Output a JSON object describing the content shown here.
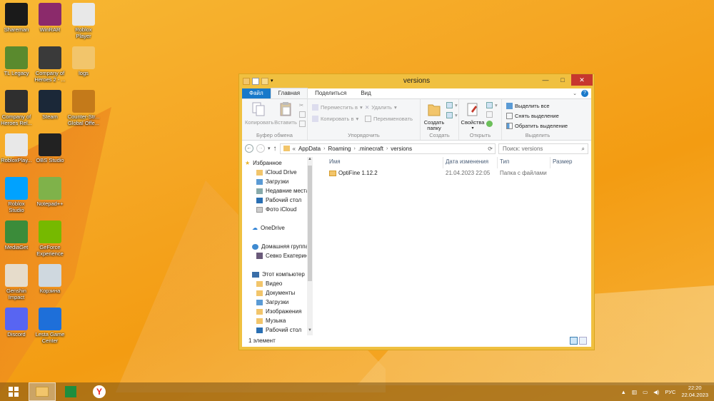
{
  "desktop": {
    "icons": [
      {
        "label": "Shareman",
        "icon": "shareman-icon",
        "color": "#1a1a1a"
      },
      {
        "label": "WinRAR",
        "icon": "winrar-icon",
        "color": "#8b2a6b"
      },
      {
        "label": "Roblox Player",
        "icon": "roblox-icon",
        "color": "#e8e8e8"
      },
      {
        "label": "TL Legacy",
        "icon": "minecraft-grass-icon",
        "color": "#5a8a2e"
      },
      {
        "label": "Company of Heroes 2 - ...",
        "icon": "coh2-icon",
        "color": "#3a3a3a"
      },
      {
        "label": "logs",
        "icon": "folder-icon",
        "color": "#f2c56b"
      },
      {
        "label": "Company of Heroes Rel...",
        "icon": "coh-icon",
        "color": "#2f2f2f"
      },
      {
        "label": "Steam",
        "icon": "steam-icon",
        "color": "#1b2838"
      },
      {
        "label": "Counter-Str... Global Offe...",
        "icon": "csgo-icon",
        "color": "#c47a1a"
      },
      {
        "label": "RobloxPlay...",
        "icon": "roblox-icon",
        "color": "#e8e8e8"
      },
      {
        "label": "OBS Studio",
        "icon": "obs-icon",
        "color": "#222"
      },
      {
        "label": "Roblox Studio",
        "icon": "roblox-studio-icon",
        "color": "#00a2ff"
      },
      {
        "label": "Notepad++",
        "icon": "notepadpp-icon",
        "color": "#7fb24a"
      },
      {
        "label": "MediaGet",
        "icon": "mediaget-icon",
        "color": "#3b8c3a"
      },
      {
        "label": "GeForce Experience",
        "icon": "nvidia-icon",
        "color": "#76b900"
      },
      {
        "label": "Genshin Impact",
        "icon": "genshin-icon",
        "color": "#e6dccb"
      },
      {
        "label": "Корзина",
        "icon": "recycle-bin-icon",
        "color": "#cfd8df"
      },
      {
        "label": "Discord",
        "icon": "discord-icon",
        "color": "#5865f2"
      },
      {
        "label": "Lesta Game Center",
        "icon": "lesta-icon",
        "color": "#1e6fd9"
      }
    ]
  },
  "window": {
    "title": "versions",
    "controls": {
      "minimize": "—",
      "maximize": "□",
      "close": "✕"
    },
    "tabs": {
      "file": "Файл",
      "home": "Главная",
      "share": "Поделиться",
      "view": "Вид"
    },
    "help": "?",
    "ribbon": {
      "clipboard": {
        "group": "Буфер обмена",
        "copy": "Копировать",
        "paste": "Вставить"
      },
      "organize": {
        "group": "Упорядочить",
        "move_to": "Переместить в",
        "copy_to": "Копировать в",
        "delete": "Удалить",
        "rename": "Переименовать"
      },
      "new": {
        "group": "Создать",
        "new_folder": "Создать папку"
      },
      "open": {
        "group": "Открыть",
        "properties": "Свойства"
      },
      "select": {
        "group": "Выделить",
        "select_all": "Выделить все",
        "select_none": "Снять выделение",
        "invert": "Обратить выделение"
      }
    },
    "address": {
      "prefix": "«",
      "crumbs": [
        "AppData",
        "Roaming",
        ".minecraft",
        "versions"
      ],
      "search_placeholder": "Поиск: versions"
    },
    "nav": {
      "favorites": "Избранное",
      "items": [
        "iCloud Drive",
        "Загрузки",
        "Недавние места",
        "Рабочий стол",
        "Фото iCloud"
      ],
      "onedrive": "OneDrive",
      "homegroup": "Домашняя группа",
      "homegroup_user": "Севко Екатерина",
      "this_pc": "Этот компьютер",
      "pc_items": [
        "Видео",
        "Документы",
        "Загрузки",
        "Изображения",
        "Музыка",
        "Рабочий стол"
      ]
    },
    "columns": {
      "name": "Имя",
      "date": "Дата изменения",
      "type": "Тип",
      "size": "Размер"
    },
    "files": [
      {
        "name": "OptiFine 1.12.2",
        "date": "21.04.2023 22:05",
        "type": "Папка с файлами",
        "size": ""
      }
    ],
    "status": "1 элемент"
  },
  "taskbar": {
    "language": "РУС",
    "time": "22:20",
    "date": "22.04.2023"
  }
}
